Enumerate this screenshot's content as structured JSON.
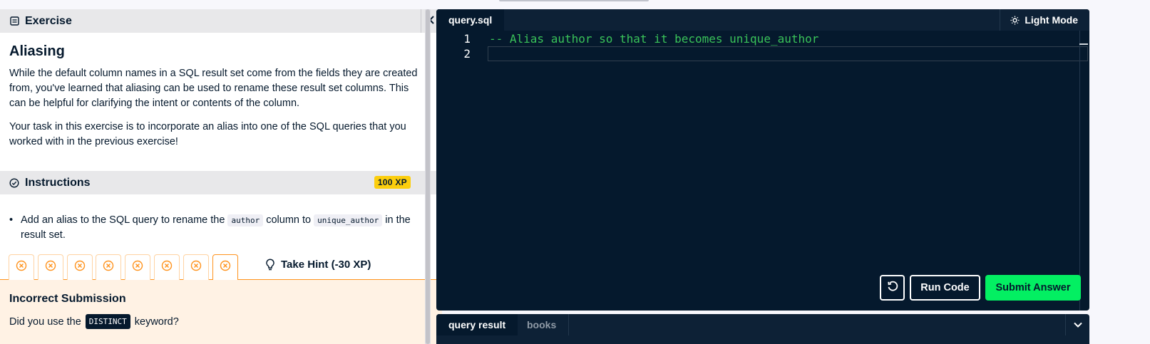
{
  "exercise": {
    "header_label": "Exercise",
    "title": "Aliasing",
    "paragraph_1": "While the default column names in a SQL result set come from the fields they are created from, you've learned that aliasing can be used to rename these result set columns. This can be helpful for clarifying the intent or contents of the column.",
    "paragraph_2": "Your task in this exercise is to incorporate an alias into one of the SQL queries that you worked with in the previous exercise!"
  },
  "instructions": {
    "header_label": "Instructions",
    "xp_badge": "100 XP",
    "bullet_before": "Add an alias to the SQL query to rename the",
    "code_1": "author",
    "bullet_middle": "column to",
    "code_2": "unique_author",
    "bullet_after": "in the result set."
  },
  "hint": {
    "attempts": 8,
    "take_hint_label": "Take Hint (-30 XP)"
  },
  "feedback": {
    "title": "Incorrect Submission",
    "text_before": "Did you use the",
    "keyword": "DISTINCT",
    "text_after": "keyword?"
  },
  "editor": {
    "tab_label": "query.sql",
    "light_mode_label": "Light Mode",
    "lines": [
      {
        "number": "1",
        "text": "-- Alias author so that it becomes unique_author"
      },
      {
        "number": "2",
        "text": ""
      }
    ],
    "run_label": "Run Code",
    "submit_label": "Submit Answer"
  },
  "results": {
    "tabs": [
      {
        "label": "query result"
      },
      {
        "label": "books"
      }
    ]
  },
  "colors": {
    "editor_bg": "#05192d",
    "accent_green": "#03ef62",
    "comment_green": "#3ac359",
    "feedback_bg": "#fff2e4",
    "attempt_orange": "#ff931e",
    "xp_yellow": "#fcce0d"
  }
}
